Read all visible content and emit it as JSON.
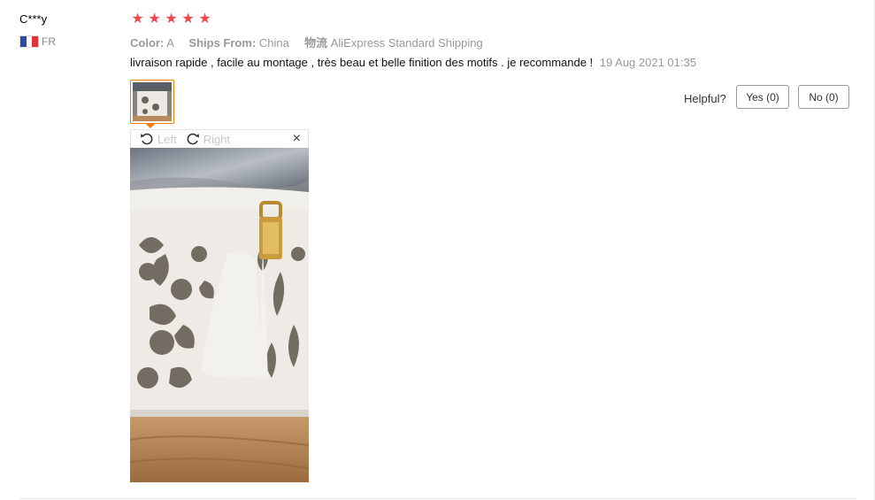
{
  "review": {
    "user": "C***y",
    "country": {
      "code": "FR",
      "flag_colors": [
        "#2c4aa6",
        "#ffffff",
        "#e0323c"
      ]
    },
    "rating": {
      "stars": 5,
      "max": 5,
      "star_glyph": "★",
      "color": "#f0484e"
    },
    "attributes": [
      {
        "key": "Color:",
        "value": "A"
      },
      {
        "key": "Ships From:",
        "value": "China"
      },
      {
        "key": "物流",
        "value": "AliExpress Standard Shipping"
      }
    ],
    "text": "livraison rapide , facile au montage , très beau et belle finition des motifs . je recommande !",
    "date": "19 Aug 2021 01:35",
    "image_viewer": {
      "rotate_left_label": "Left",
      "rotate_right_label": "Right",
      "close_glyph": "×",
      "thumb_border_color": "#f07c00"
    },
    "helpful": {
      "label": "Helpful?",
      "yes_label": "Yes (0)",
      "no_label": "No (0)"
    }
  }
}
